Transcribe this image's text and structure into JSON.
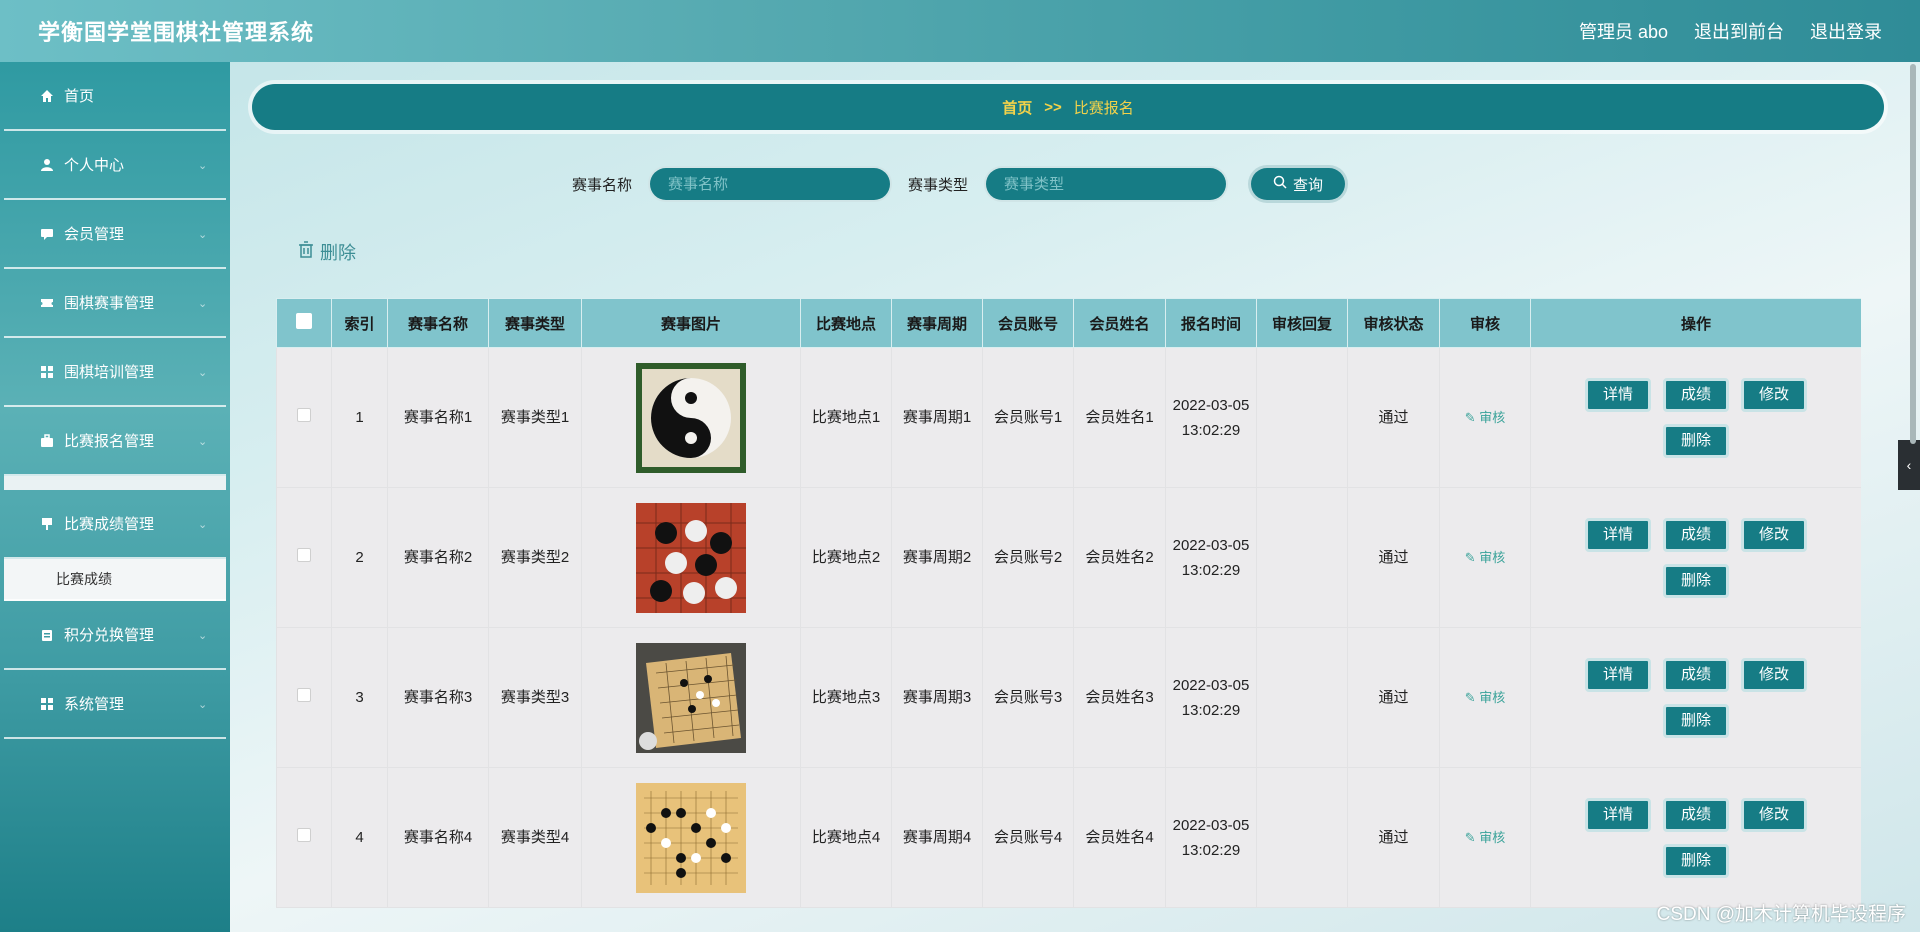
{
  "header": {
    "title": "学衡国学堂围棋社管理系统",
    "admin_label": "管理员 abo",
    "to_front": "退出到前台",
    "logout": "退出登录"
  },
  "sidebar": {
    "items": [
      {
        "label": "首页",
        "icon": "home-icon"
      },
      {
        "label": "个人中心",
        "icon": "user-icon"
      },
      {
        "label": "会员管理",
        "icon": "chat-icon"
      },
      {
        "label": "围棋赛事管理",
        "icon": "ticket-icon"
      },
      {
        "label": "围棋培训管理",
        "icon": "grid-icon"
      },
      {
        "label": "比赛报名管理",
        "icon": "briefcase-icon"
      },
      {
        "label": "比赛成绩管理",
        "icon": "flag-icon"
      },
      {
        "label": "积分兑换管理",
        "icon": "clipboard-icon"
      },
      {
        "label": "系统管理",
        "icon": "grid-icon"
      }
    ],
    "submenu_label": "比赛成绩"
  },
  "breadcrumb": {
    "home": "首页",
    "separator": ">>",
    "current": "比赛报名"
  },
  "search": {
    "name_label": "赛事名称",
    "name_placeholder": "赛事名称",
    "type_label": "赛事类型",
    "type_placeholder": "赛事类型",
    "query_label": "查询"
  },
  "delete_label": "删除",
  "table": {
    "headers": [
      "索引",
      "赛事名称",
      "赛事类型",
      "赛事图片",
      "比赛地点",
      "赛事周期",
      "会员账号",
      "会员姓名",
      "报名时间",
      "审核回复",
      "审核状态",
      "审核",
      "操作"
    ],
    "rows": [
      {
        "index": "1",
        "name": "赛事名称1",
        "type": "赛事类型1",
        "place": "比赛地点1",
        "period": "赛事周期1",
        "account": "会员账号1",
        "member": "会员姓名1",
        "time": "2022-03-05 13:02:29",
        "reply": "",
        "status": "通过",
        "audit": "审核"
      },
      {
        "index": "2",
        "name": "赛事名称2",
        "type": "赛事类型2",
        "place": "比赛地点2",
        "period": "赛事周期2",
        "account": "会员账号2",
        "member": "会员姓名2",
        "time": "2022-03-05 13:02:29",
        "reply": "",
        "status": "通过",
        "audit": "审核"
      },
      {
        "index": "3",
        "name": "赛事名称3",
        "type": "赛事类型3",
        "place": "比赛地点3",
        "period": "赛事周期3",
        "account": "会员账号3",
        "member": "会员姓名3",
        "time": "2022-03-05 13:02:29",
        "reply": "",
        "status": "通过",
        "audit": "审核"
      },
      {
        "index": "4",
        "name": "赛事名称4",
        "type": "赛事类型4",
        "place": "比赛地点4",
        "period": "赛事周期4",
        "account": "会员账号4",
        "member": "会员姓名4",
        "time": "2022-03-05 13:02:29",
        "reply": "",
        "status": "通过",
        "audit": "审核"
      }
    ],
    "op_buttons": {
      "detail": "详情",
      "score": "成绩",
      "edit": "修改",
      "delete": "删除"
    }
  },
  "watermark": "CSDN @加木计算机毕设程序",
  "colors": {
    "accent": "#167c85",
    "header": "#4aa3ab",
    "breadcrumb_text": "#f2d24a"
  }
}
